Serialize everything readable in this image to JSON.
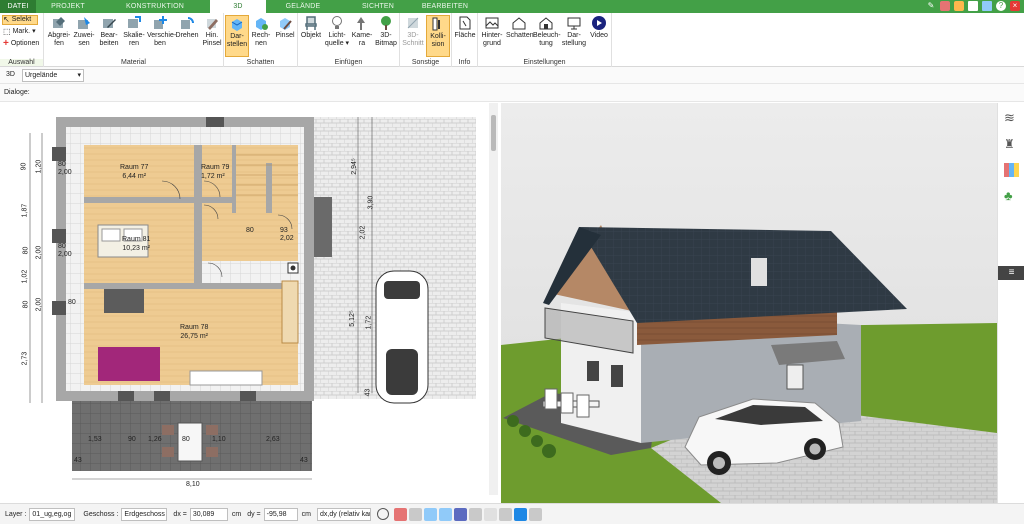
{
  "tabs": [
    "DATEI",
    "PROJEKT",
    "KONSTRUKTION",
    "3D",
    "GELÄNDE",
    "SICHTEN",
    "BEARBEITEN"
  ],
  "ribbon": {
    "select": {
      "selekt": "Selekt",
      "mark": "Mark.",
      "optionen": "Optionen",
      "group": "Auswahl"
    },
    "material": {
      "buttons": [
        {
          "l1": "Abgrei-",
          "l2": "fen"
        },
        {
          "l1": "Zuwei-",
          "l2": "sen"
        },
        {
          "l1": "Bear-",
          "l2": "beiten"
        },
        {
          "l1": "Skalie-",
          "l2": "ren"
        },
        {
          "l1": "Verschie-",
          "l2": "ben"
        },
        {
          "l1": "Drehen",
          "l2": ""
        },
        {
          "l1": "Hin.",
          "l2": "Pinsel"
        }
      ],
      "group": "Material"
    },
    "schatten": {
      "buttons": [
        {
          "l1": "Dar-",
          "l2": "stellen"
        },
        {
          "l1": "Rech-",
          "l2": "nen"
        },
        {
          "l1": "Pinsel",
          "l2": ""
        }
      ],
      "group": "Schatten"
    },
    "einfuegen": {
      "buttons": [
        {
          "l1": "Objekt",
          "l2": ""
        },
        {
          "l1": "Licht-",
          "l2": "quelle ▾"
        },
        {
          "l1": "Kame-",
          "l2": "ra"
        },
        {
          "l1": "3D-",
          "l2": "Bitmap"
        }
      ],
      "group": "Einfügen"
    },
    "sonstige": {
      "buttons": [
        {
          "l1": "3D-",
          "l2": "Schnitt"
        },
        {
          "l1": "Kolli-",
          "l2": "sion"
        }
      ],
      "group": "Sonstige"
    },
    "info": {
      "buttons": [
        {
          "l1": "Fläche",
          "l2": ""
        }
      ],
      "group": "Info"
    },
    "einstellungen": {
      "buttons": [
        {
          "l1": "Hinter-",
          "l2": "grund"
        },
        {
          "l1": "Schatten",
          "l2": ""
        },
        {
          "l1": "Beleuch-",
          "l2": "tung"
        },
        {
          "l1": "Dar-",
          "l2": "stellung"
        },
        {
          "l1": "Video",
          "l2": ""
        }
      ],
      "group": "Einstellungen"
    }
  },
  "toolbar": {
    "mode": "3D",
    "terrain": "Urgelände",
    "dialoge": "Dialoge:"
  },
  "plan": {
    "rooms": [
      {
        "name": "Raum 77",
        "area": "6,44 m²"
      },
      {
        "name": "Raum 79",
        "area": "1,72 m²"
      },
      {
        "name": "Raum 81",
        "area": "10,23 m²"
      },
      {
        "name": "Raum 78",
        "area": "26,75 m²"
      }
    ],
    "dims_left": [
      "90",
      "1,20",
      "1,87",
      "80",
      "2,00",
      "1,02",
      "80",
      "2,00",
      "2,73"
    ],
    "dims_bottom": [
      "1,53",
      "90",
      "1,26",
      "80",
      "1,10",
      "2,63"
    ],
    "dim_total": "8,10",
    "dims_side": [
      "43",
      "43",
      "43"
    ],
    "dims_right": [
      "2,94⁵",
      "3,90",
      "2,02",
      "5,12⁵",
      "1,72"
    ],
    "misc": [
      "80",
      "2,00",
      "80",
      "2,00",
      "80",
      "93",
      "2,02",
      "80"
    ]
  },
  "status": {
    "layer_label": "Layer :",
    "layer_value": "01_ug,eg,og",
    "geschoss_label": "Geschoss :",
    "geschoss_value": "Erdgeschoss",
    "dx_label": "dx =",
    "dx_value": "30,089",
    "dx_unit": "cm",
    "dy_label": "dy =",
    "dy_value": "-95,98",
    "dy_unit": "cm",
    "mode_value": "dx,dy (relativ kar"
  },
  "colors": {
    "accent": "#43a047",
    "active": "#ffd98a",
    "floor": "#eecb92",
    "lawn": "#6e9c2e",
    "roof": "#2f3a44"
  }
}
